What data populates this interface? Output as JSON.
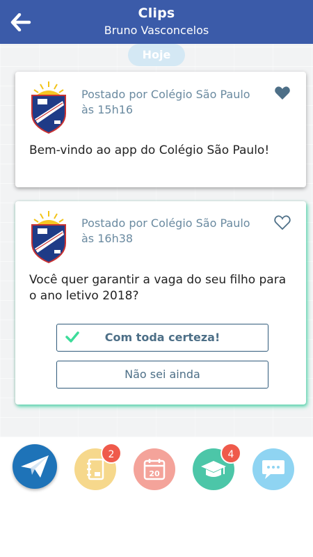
{
  "header": {
    "title": "Clips",
    "subtitle": "Bruno Vasconcelos"
  },
  "feed": {
    "day_label": "Hoje",
    "posts": [
      {
        "posted_by": "Postado por Colégio São Paulo",
        "time": "às 15h16",
        "message": "Bem-vindo ao app do Colégio São Paulo!",
        "liked": true
      },
      {
        "posted_by": "Postado por Colégio São Paulo",
        "time": "às 16h38",
        "message": "Você quer garantir a vaga do seu filho para o ano letivo 2018?",
        "liked": false,
        "answers": [
          {
            "label": "Com toda certeza!",
            "selected": true
          },
          {
            "label": "Não sei ainda",
            "selected": false
          }
        ]
      }
    ]
  },
  "bottom_nav": {
    "items": [
      {
        "icon": "paper-plane-icon",
        "color": "#1e73b8"
      },
      {
        "icon": "notebook-icon",
        "color": "#f6d88c",
        "badge": "2"
      },
      {
        "icon": "calendar-icon",
        "color": "#f4a39a",
        "calendar_day": "20"
      },
      {
        "icon": "graduation-cap-icon",
        "color": "#4cc6a8",
        "badge": "4"
      },
      {
        "icon": "chat-bubble-icon",
        "color": "#8fd4f2"
      }
    ]
  },
  "colors": {
    "header": "#3b5ba9",
    "accent_green": "#3ddc9a",
    "heart": "#4d6f87",
    "badge": "#ef5a4b"
  }
}
